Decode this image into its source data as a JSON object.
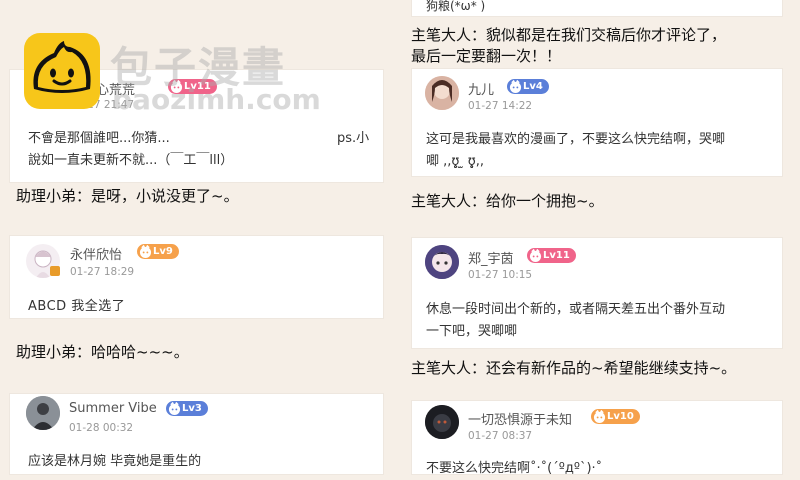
{
  "watermark": {
    "title": "包子漫畫",
    "url": "baozimh.com"
  },
  "left": {
    "c1": {
      "username": "月光心荒荒",
      "level": "Lv11",
      "time": "01-27 21:47",
      "line1a": "不會是那個誰吧...你猜...",
      "line1b": "ps.小",
      "line2": "說如一直未更新不就...（￣工￣lll）"
    },
    "reply1": "助理小弟：是呀，小说没更了~。",
    "c2": {
      "username": "永伴欣怡",
      "level": "Lv9",
      "time": "01-27 18:29",
      "text": "ABCD 我全选了"
    },
    "reply2": "助理小弟：哈哈哈~~~。",
    "c3": {
      "username": "Summer Vibe",
      "level": "Lv3",
      "time": "01-28 00:32",
      "text": "应该是林月婉 毕竟她是重生的"
    }
  },
  "right": {
    "top_tail": "狗粮(*ω* )",
    "reply0_line1": "主笔大人：貌似都是在我们交稿后你才评论了，",
    "reply0_line2": "最后一定要翻一次！！",
    "c1": {
      "username": "九儿",
      "level": "Lv4",
      "time": "01-27 14:22",
      "line1": "这可是我最喜欢的漫画了，不要这么快完结啊，哭唧",
      "line2": "唧 ,,ʊ̥̥̥̥̥ ̫ ʊ̥̥̥̥̥,,"
    },
    "reply1": "主笔大人：给你一个拥抱~。",
    "c2": {
      "username": "郑_宇茵",
      "level": "Lv11",
      "time": "01-27 10:15",
      "line1": "休息一段时间出个新的，或者隔天差五出个番外互动",
      "line2": "一下吧，哭唧唧"
    },
    "reply2": "主笔大人：还会有新作品的~希望能继续支持~。",
    "c3": {
      "username": "一切恐惧源于未知",
      "level": "Lv10",
      "time": "01-27 08:37",
      "text": "不要这么快完结啊˚·˚(´ºдº`)·˚"
    }
  }
}
